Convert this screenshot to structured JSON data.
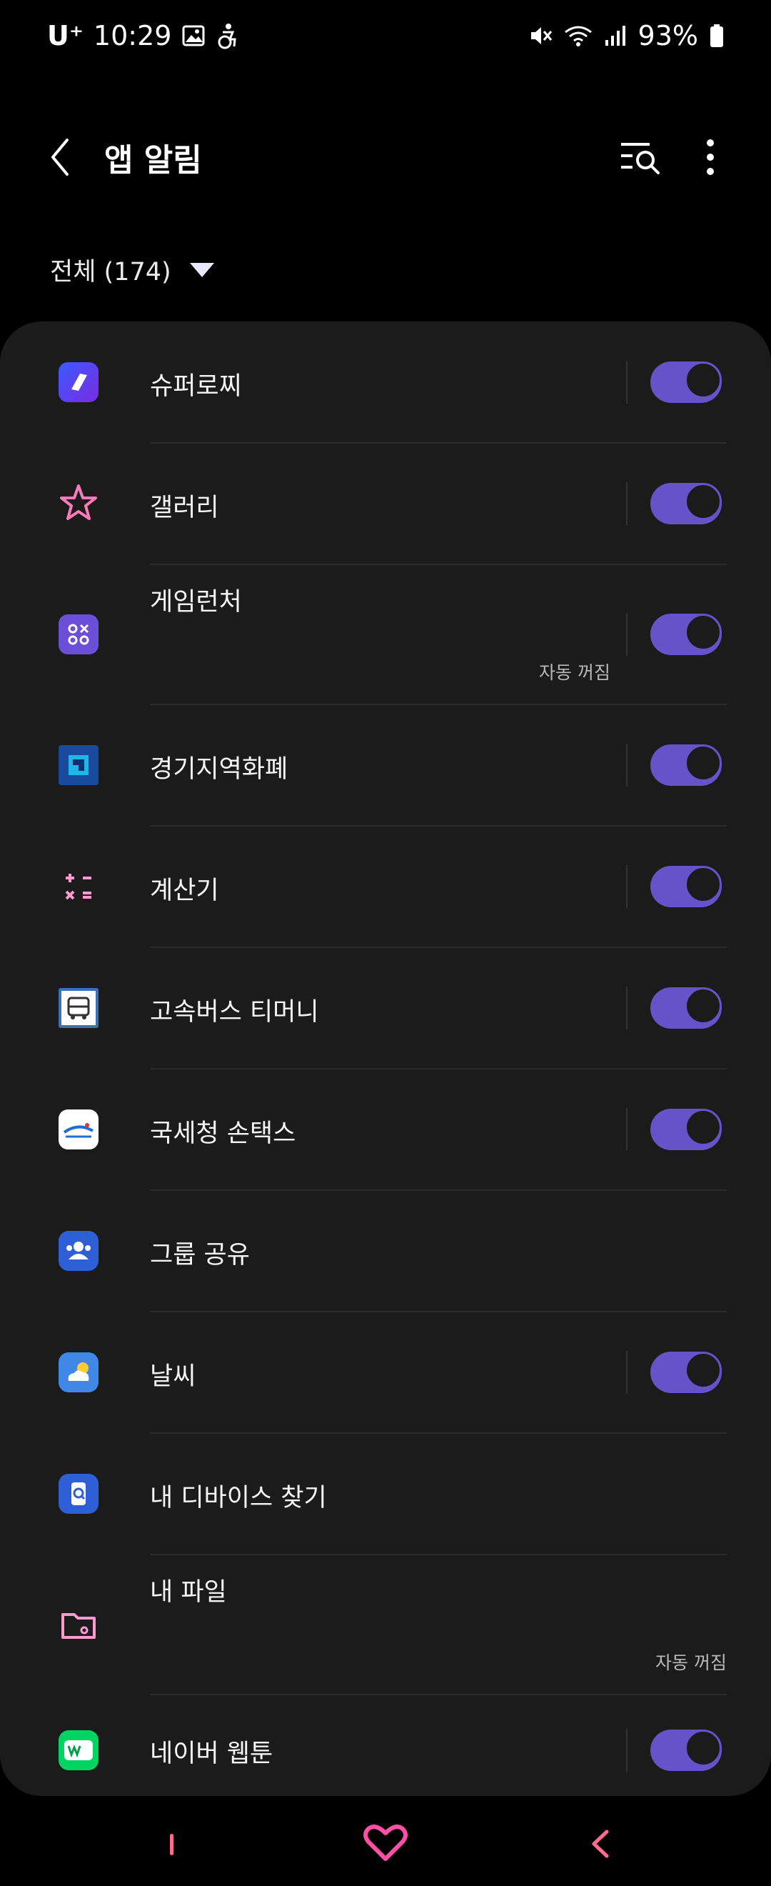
{
  "status_bar": {
    "carrier": "U⁺",
    "time": "10:29",
    "battery": "93%"
  },
  "header": {
    "title": "앱 알림",
    "filter_label": "전체 (174)"
  },
  "apps": [
    {
      "name": "슈퍼로찌",
      "toggle": true,
      "sub": ""
    },
    {
      "name": "갤러리",
      "toggle": true,
      "sub": ""
    },
    {
      "name": "게임런처",
      "toggle": true,
      "sub": "자동 꺼짐"
    },
    {
      "name": "경기지역화폐",
      "toggle": true,
      "sub": ""
    },
    {
      "name": "계산기",
      "toggle": true,
      "sub": ""
    },
    {
      "name": "고속버스 티머니",
      "toggle": true,
      "sub": ""
    },
    {
      "name": "국세청 손택스",
      "toggle": true,
      "sub": ""
    },
    {
      "name": "그룹 공유",
      "toggle": false,
      "sub": ""
    },
    {
      "name": "날씨",
      "toggle": true,
      "sub": ""
    },
    {
      "name": "내 디바이스 찾기",
      "toggle": false,
      "sub": ""
    },
    {
      "name": "내 파일",
      "toggle": false,
      "sub": "자동 꺼짐"
    },
    {
      "name": "네이버 웹툰",
      "toggle": true,
      "sub": ""
    }
  ],
  "colors": {
    "accent": "#6753c9",
    "card": "#1b1b1b",
    "background": "#000000",
    "nav_pink": "#ff6b8a"
  },
  "icons": [
    "back-icon",
    "search-list-icon",
    "more-vert-icon",
    "dropdown-triangle-icon"
  ]
}
